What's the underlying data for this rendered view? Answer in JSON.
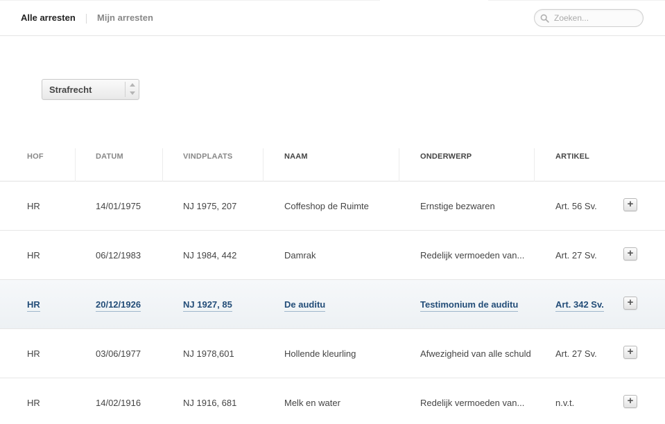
{
  "nav": {
    "tab_all": "Alle arresten",
    "tab_mine": "Mijn arresten"
  },
  "search": {
    "placeholder": "Zoeken...",
    "icon": "search-icon"
  },
  "filter": {
    "selected": "Strafrecht"
  },
  "table": {
    "columns": [
      "HOF",
      "DATUM",
      "VINDPLAATS",
      "NAAM",
      "ONDERWERP",
      "ARTIKEL"
    ],
    "rows": [
      {
        "hof": "HR",
        "datum": "14/01/1975",
        "vindplaats": "NJ 1975, 207",
        "naam": "Coffeshop de Ruimte",
        "onderwerp": "Ernstige bezwaren",
        "artikel": "Art. 56 Sv.",
        "active": false
      },
      {
        "hof": "HR",
        "datum": "06/12/1983",
        "vindplaats": "NJ 1984, 442",
        "naam": "Damrak",
        "onderwerp": "Redelijk vermoeden van...",
        "artikel": "Art. 27 Sv.",
        "active": false
      },
      {
        "hof": "HR",
        "datum": "20/12/1926",
        "vindplaats": "NJ 1927, 85",
        "naam": "De auditu",
        "onderwerp": "Testimonium de auditu",
        "artikel": "Art. 342 Sv.",
        "active": true
      },
      {
        "hof": "HR",
        "datum": "03/06/1977",
        "vindplaats": "NJ 1978,601",
        "naam": "Hollende kleurling",
        "onderwerp": "Afwezigheid van alle schuld",
        "artikel": "Art. 27 Sv.",
        "active": false
      },
      {
        "hof": "HR",
        "datum": "14/02/1916",
        "vindplaats": "NJ 1916, 681",
        "naam": "Melk en water",
        "onderwerp": "Redelijk vermoeden van...",
        "artikel": "n.v.t.",
        "active": false
      }
    ],
    "add_button_label": "+"
  },
  "colors": {
    "active_text": "#234d78",
    "active_row_bg": "#edf1f4"
  }
}
